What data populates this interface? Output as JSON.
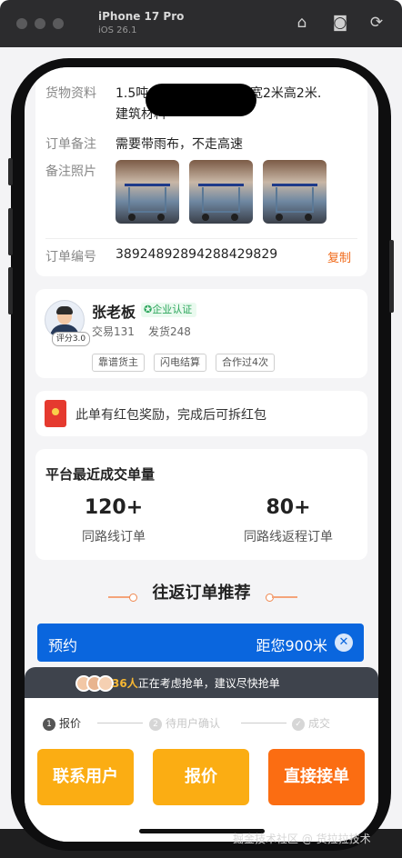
{
  "simulator": {
    "device": "iPhone 17 Pro",
    "os": "iOS 26.1"
  },
  "order": {
    "cargo_label": "货物资料",
    "cargo_value_line1": "1.5吨",
    "cargo_value_line1b": "长宽2米高2米.",
    "cargo_value_line2": "建筑材料",
    "remark_label": "订单备注",
    "remark_value": "需要带雨布，不走高速",
    "photos_label": "备注照片",
    "order_no_label": "订单编号",
    "order_no_value": "38924892894288429829",
    "copy_label": "复制"
  },
  "shipper": {
    "name": "张老板",
    "badge": "企业认证",
    "trades": "交易131",
    "shipments": "发货248",
    "score": "评分3.0",
    "tags": [
      "靠谱货主",
      "闪电结算",
      "合作过4次"
    ]
  },
  "bonus": {
    "text": "此单有红包奖励，完成后可拆红包"
  },
  "stats": {
    "title": "平台最近成交单量",
    "same_route_value": "120+",
    "same_route_label": "同路线订单",
    "return_route_value": "80+",
    "return_route_label": "同路线返程订单"
  },
  "recommend": {
    "title": "往返订单推荐"
  },
  "promo_bar": {
    "left": "预约",
    "right": "距您900米",
    "close": "✕"
  },
  "crowd": {
    "count": "36人",
    "text": "正在考虑抢单，建议尽快抢单"
  },
  "steps": [
    {
      "num": "1",
      "label": "报价"
    },
    {
      "num": "2",
      "label": "待用户确认"
    },
    {
      "num": "✓",
      "label": "成交"
    }
  ],
  "actions": {
    "contact": "联系用户",
    "quote": "报价",
    "accept": "直接接单"
  },
  "colors": {
    "accent_orange": "#f06a1a",
    "yellow_button": "#fbad13",
    "orange_button": "#fb6d12",
    "promo_blue": "#0a66de"
  },
  "watermark": "掘金技术社区 @ 货拉拉技术"
}
